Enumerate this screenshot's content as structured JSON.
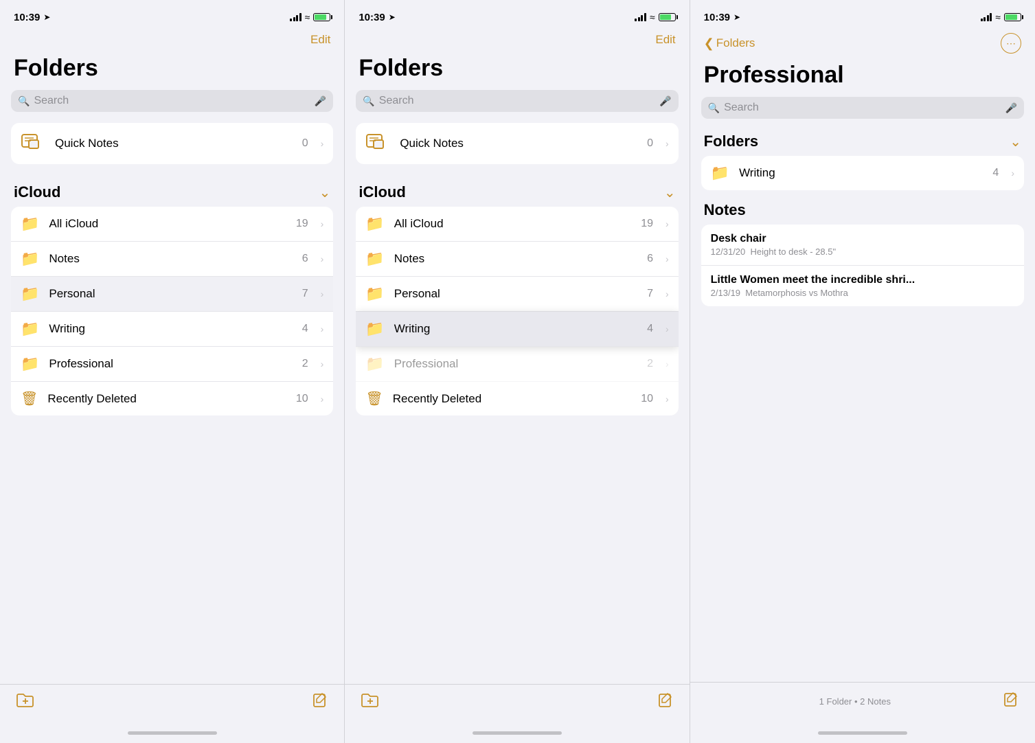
{
  "colors": {
    "accent": "#c8922a",
    "text_primary": "#000000",
    "text_secondary": "#8e8e93",
    "chevron": "#c7c7cc",
    "bg_card": "#ffffff",
    "bg_page": "#f2f2f7",
    "separator": "#e5e5ea"
  },
  "panel1": {
    "status_time": "10:39",
    "edit_label": "Edit",
    "title": "Folders",
    "search_placeholder": "Search",
    "quick_notes": {
      "label": "Quick Notes",
      "count": "0"
    },
    "icloud_section": "iCloud",
    "folders": [
      {
        "name": "All iCloud",
        "count": "19",
        "type": "folder"
      },
      {
        "name": "Notes",
        "count": "6",
        "type": "folder"
      },
      {
        "name": "Personal",
        "count": "7",
        "type": "folder",
        "highlighted": true
      },
      {
        "name": "Writing",
        "count": "4",
        "type": "folder"
      },
      {
        "name": "Professional",
        "count": "2",
        "type": "folder"
      },
      {
        "name": "Recently Deleted",
        "count": "10",
        "type": "trash"
      }
    ],
    "new_folder_label": "new-folder",
    "compose_label": "compose"
  },
  "panel2": {
    "status_time": "10:39",
    "edit_label": "Edit",
    "title": "Folders",
    "search_placeholder": "Search",
    "quick_notes": {
      "label": "Quick Notes",
      "count": "0"
    },
    "icloud_section": "iCloud",
    "folders": [
      {
        "name": "All iCloud",
        "count": "19",
        "type": "folder"
      },
      {
        "name": "Notes",
        "count": "6",
        "type": "folder"
      },
      {
        "name": "Personal",
        "count": "7",
        "type": "folder"
      },
      {
        "name": "Writing",
        "count": "4",
        "type": "folder",
        "highlighted": true
      },
      {
        "name": "Professional",
        "count": "2",
        "type": "folder",
        "ghost": true
      },
      {
        "name": "Recently Deleted",
        "count": "10",
        "type": "trash"
      }
    ],
    "new_folder_label": "new-folder",
    "compose_label": "compose"
  },
  "panel3": {
    "status_time": "10:39",
    "back_label": "Folders",
    "title": "Professional",
    "search_placeholder": "Search",
    "folders_section": "Folders",
    "folders": [
      {
        "name": "Writing",
        "count": "4",
        "type": "folder"
      }
    ],
    "notes_section": "Notes",
    "notes": [
      {
        "title": "Desk chair",
        "date": "12/31/20",
        "preview": "Height to desk - 28.5\""
      },
      {
        "title": "Little Women meet the incredible shri...",
        "date": "2/13/19",
        "preview": "Metamorphosis vs Mothra"
      }
    ],
    "footer_count": "1 Folder • 2 Notes",
    "compose_label": "compose"
  }
}
